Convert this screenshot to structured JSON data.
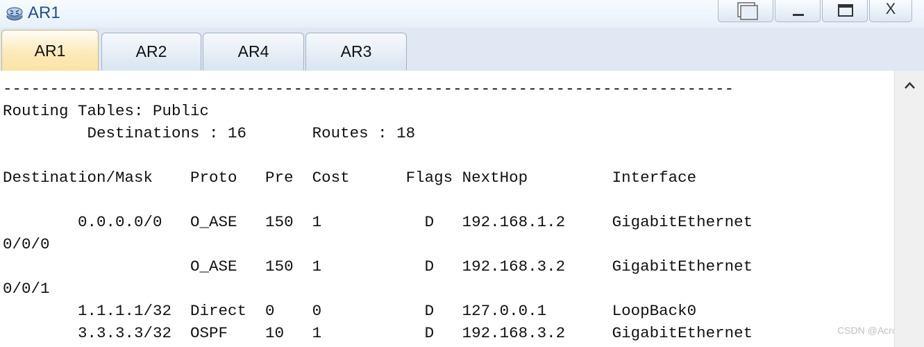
{
  "window": {
    "title": "AR1",
    "icon": "router-icon",
    "controls": [
      "restore-icon",
      "minimize-icon",
      "maximize-icon",
      "close-icon"
    ],
    "close_label": "X"
  },
  "tabs": [
    {
      "label": "AR1",
      "active": true
    },
    {
      "label": "AR2",
      "active": false
    },
    {
      "label": "AR4",
      "active": false
    },
    {
      "label": "AR3",
      "active": false
    }
  ],
  "terminal": {
    "lines": [
      "------------------------------------------------------------------------------",
      "Routing Tables: Public",
      "         Destinations : 16       Routes : 18",
      "",
      "Destination/Mask    Proto   Pre  Cost      Flags NextHop         Interface",
      "",
      "        0.0.0.0/0   O_ASE   150  1           D   192.168.1.2     GigabitEthernet",
      "0/0/0",
      "                    O_ASE   150  1           D   192.168.3.2     GigabitEthernet",
      "0/0/1",
      "        1.1.1.1/32  Direct  0    0           D   127.0.0.1       LoopBack0",
      "        3.3.3.3/32  OSPF    10   1           D   192.168.3.2     GigabitEthernet"
    ]
  },
  "watermark": "CSDN @Acrobaby"
}
